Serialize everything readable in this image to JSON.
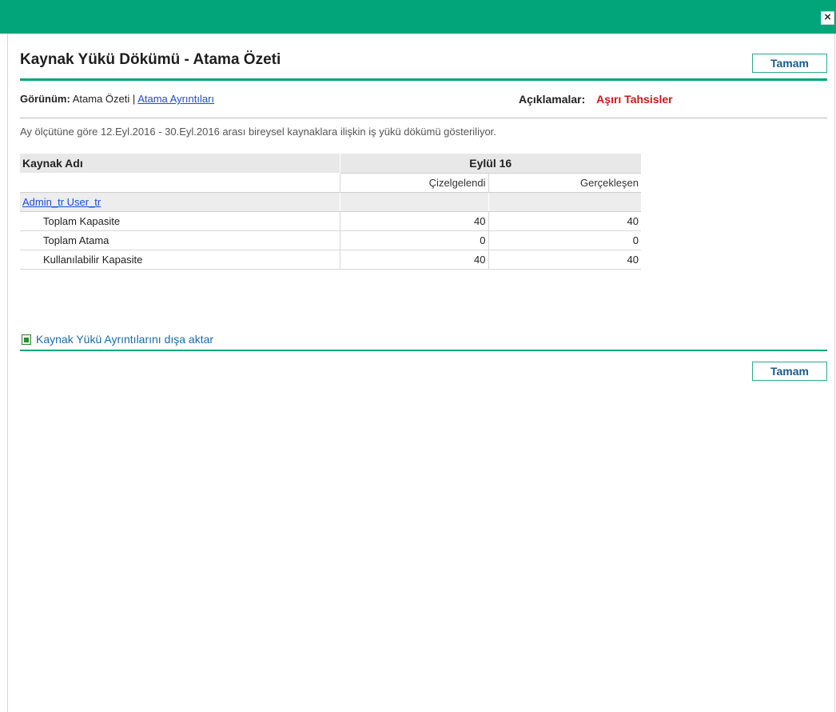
{
  "dialog": {
    "close_glyph": "×",
    "title": "Kaynak Yükü Dökümü - Atama Özeti",
    "ok_label": "Tamam"
  },
  "view": {
    "label": "Görünüm:",
    "current": "Atama Özeti",
    "separator": "|",
    "alt_link": "Atama Ayrıntıları"
  },
  "legend": {
    "label": "Açıklamalar:",
    "item": "Aşırı Tahsisler",
    "item_color": "#cc1a1a"
  },
  "description": "Ay ölçütüne göre 12.Eyl.2016 - 30.Eyl.2016 arası bireysel kaynaklara ilişkin iş yükü dökümü gösteriliyor.",
  "table": {
    "col_name": "Kaynak Adı",
    "month": "Eylül 16",
    "col_scheduled": "Çizelgelendi",
    "col_actual": "Gerçekleşen",
    "resource": "Admin_tr User_tr",
    "rows": [
      {
        "label": "Toplam Kapasite",
        "scheduled": "40",
        "actual": "40"
      },
      {
        "label": "Toplam Atama",
        "scheduled": "0",
        "actual": "0"
      },
      {
        "label": "Kullanılabilir Kapasite",
        "scheduled": "40",
        "actual": "40"
      }
    ]
  },
  "export_label": "Kaynak Yükü Ayrıntılarını dışa aktar",
  "colors": {
    "header_bar": "#02a57a",
    "rule": "#04a57a",
    "link": "#1a4dd8"
  }
}
